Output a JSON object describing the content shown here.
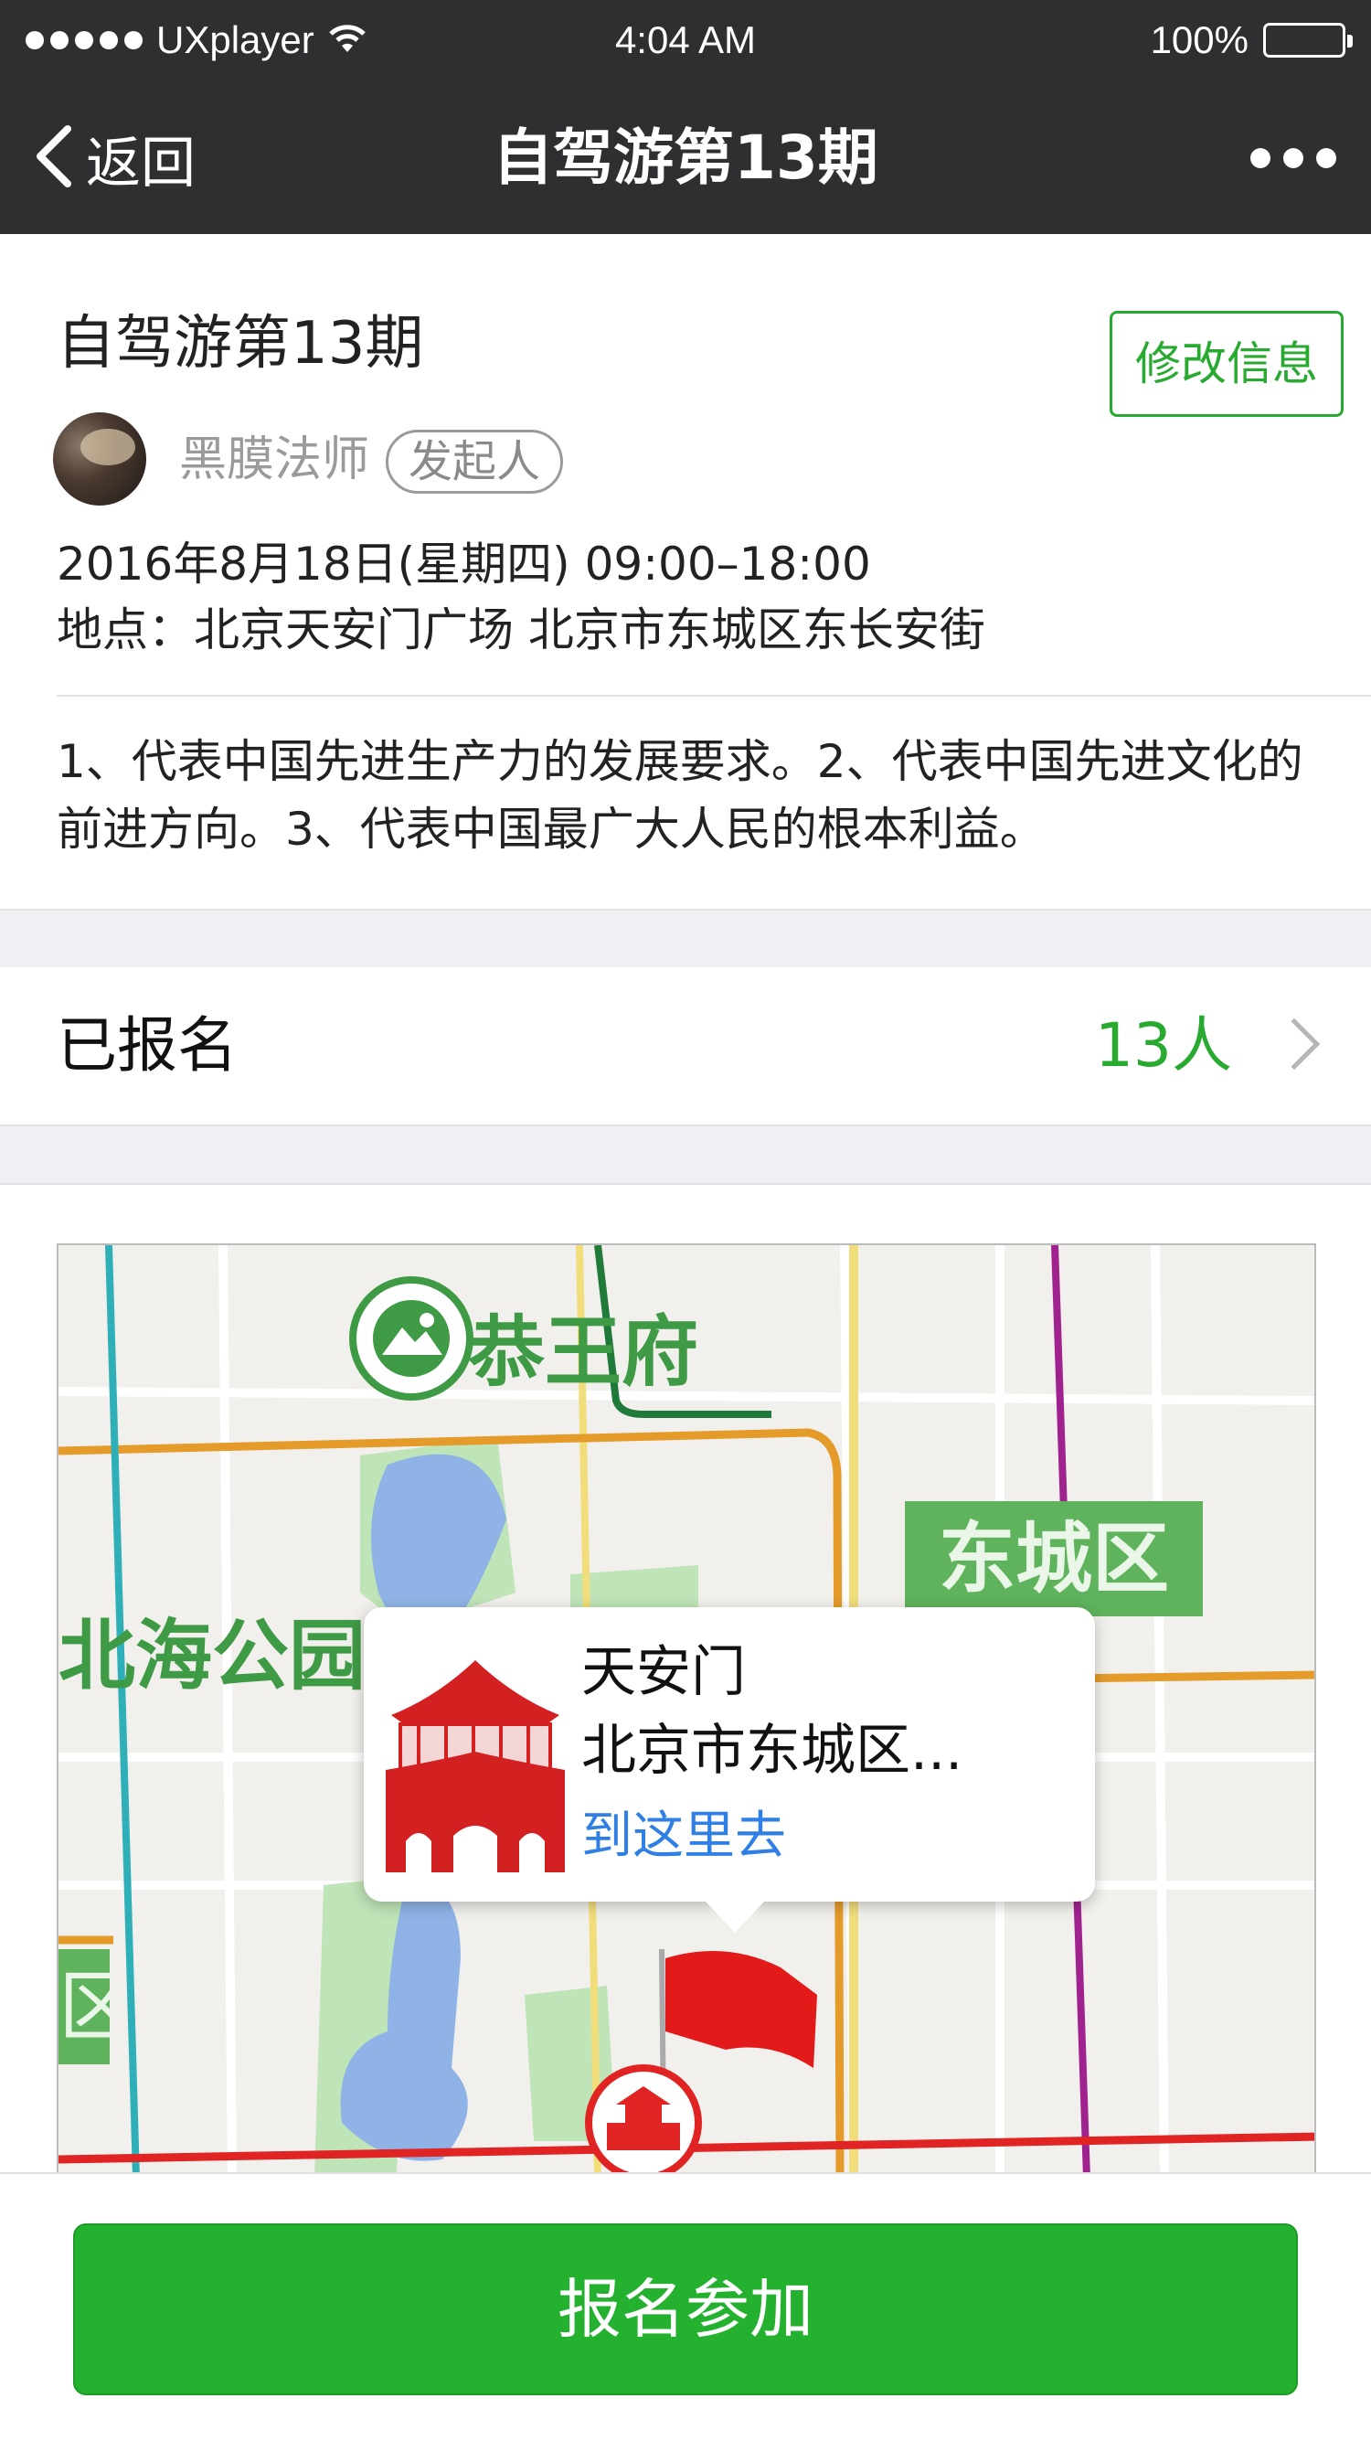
{
  "status_bar": {
    "carrier": "UXplayer",
    "time": "4:04 AM",
    "battery": "100%",
    "battery_level": 1.0,
    "signal_dots": 5
  },
  "nav": {
    "back_label": "返回",
    "title": "自驾游第13期",
    "more_icon": "more-dots-icon"
  },
  "event": {
    "title": "自驾游第13期",
    "edit_label": "修改信息",
    "organizer_name": "黑膜法师",
    "organizer_role": "发起人",
    "datetime": "2016年8月18日(星期四)   09:00–18:00",
    "location": "地点：北京天安门广场   北京市东城区东长安街",
    "description": "1、代表中国先进生产力的发展要求。2、代表中国先进文化的前进方向。3、代表中国最广大人民的根本利益。"
  },
  "registered": {
    "label": "已报名",
    "count": "13人"
  },
  "map": {
    "poi_park": "恭王府",
    "poi_beihai": "北海公园",
    "district": "东城区",
    "district_partial": "区",
    "callout": {
      "title": "天安门",
      "address": "北京市东城区...",
      "link": "到这里去"
    }
  },
  "action": {
    "join_label": "报名参加"
  },
  "colors": {
    "accent_green": "#28a930",
    "button_green": "#24b12f",
    "link_blue": "#2f7fe5",
    "nav_dark": "#2f2f31"
  }
}
